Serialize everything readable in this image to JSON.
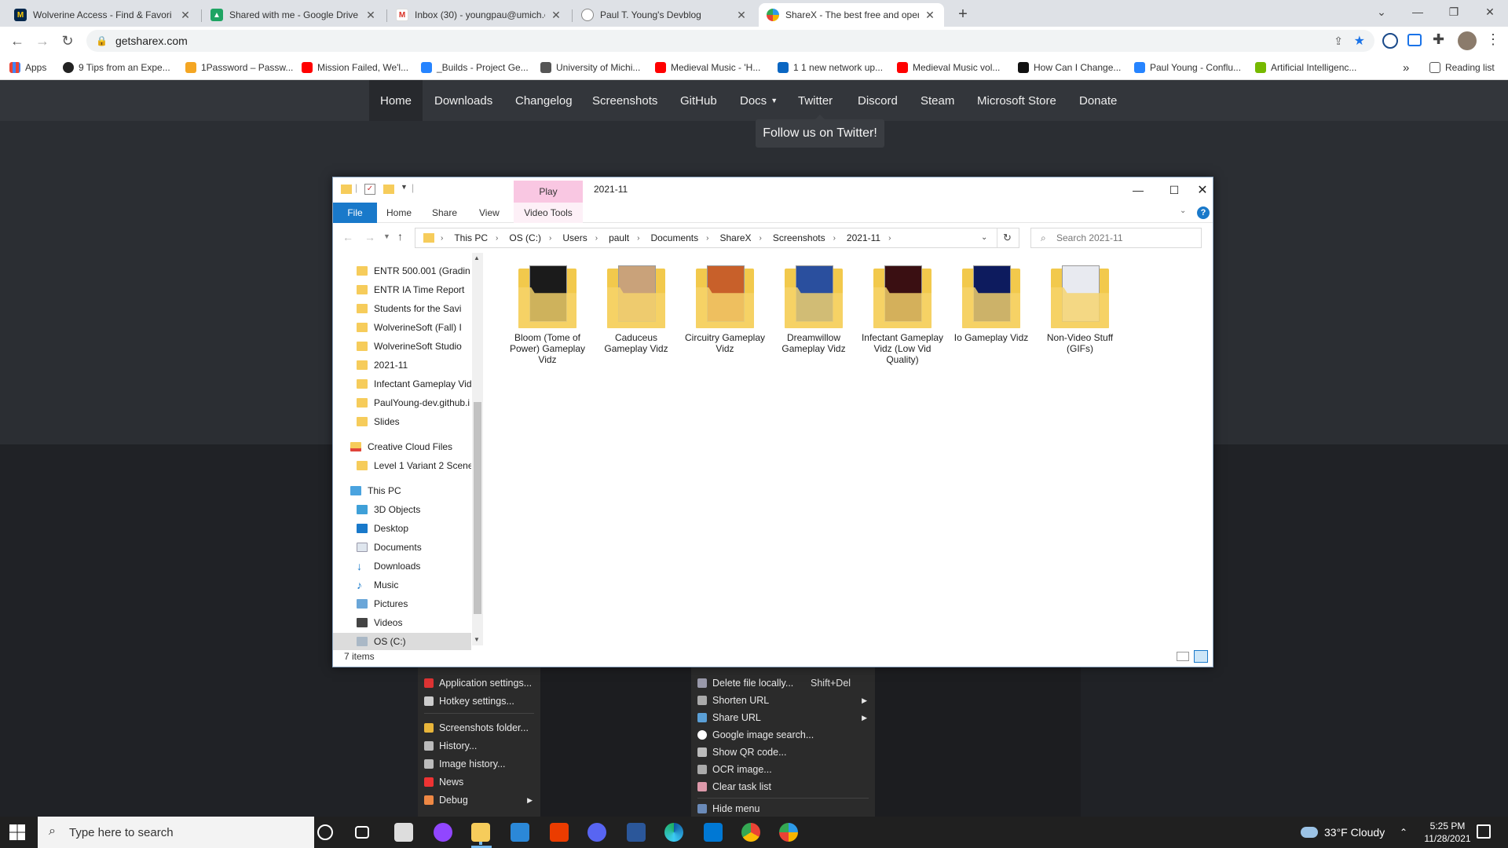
{
  "browser": {
    "tabs": [
      {
        "title": "Wolverine Access - Find & Favori",
        "icon": "wolverine-icon",
        "color": "#00274c"
      },
      {
        "title": "Shared with me - Google Drive",
        "icon": "drive-icon",
        "color": "#1fa463"
      },
      {
        "title": "Inbox (30) - youngpau@umich.e",
        "icon": "gmail-icon",
        "color": "#d93025"
      },
      {
        "title": "Paul T. Young's Devblog",
        "icon": "globe-icon",
        "color": "#666666"
      },
      {
        "title": "ShareX - The best free and open",
        "icon": "sharex-icon",
        "color": "#2d9ae8"
      }
    ],
    "new_tab": "+",
    "url": "getsharex.com",
    "bookmarks": [
      {
        "label": "Apps"
      },
      {
        "label": "9 Tips from an Expe..."
      },
      {
        "label": "1Password – Passw..."
      },
      {
        "label": "Mission Failed, We'l..."
      },
      {
        "label": "_Builds - Project Ge..."
      },
      {
        "label": "University of Michi..."
      },
      {
        "label": "Medieval Music - 'H..."
      },
      {
        "label": "1 1 new network up..."
      },
      {
        "label": "Medieval Music vol..."
      },
      {
        "label": "How Can I Change..."
      },
      {
        "label": "Paul Young - Conflu..."
      },
      {
        "label": "Artificial Intelligenc..."
      }
    ],
    "more": "»",
    "reading_list": "Reading list"
  },
  "site": {
    "nav": [
      "Home",
      "Downloads",
      "Changelog",
      "Screenshots",
      "GitHub",
      "Docs",
      "Twitter",
      "Discord",
      "Steam",
      "Microsoft Store",
      "Donate"
    ],
    "tooltip": "Follow us on Twitter!"
  },
  "sharex_menu_left": [
    {
      "label": "Application settings..."
    },
    {
      "label": "Hotkey settings..."
    },
    {
      "label": "Screenshots folder..."
    },
    {
      "label": "History..."
    },
    {
      "label": "Image history..."
    },
    {
      "label": "News"
    },
    {
      "label": "Debug"
    }
  ],
  "sharex_menu_right": [
    {
      "label": "Delete file locally...",
      "shortcut": "Shift+Del"
    },
    {
      "label": "Shorten URL"
    },
    {
      "label": "Share URL"
    },
    {
      "label": "Google image search..."
    },
    {
      "label": "Show QR code..."
    },
    {
      "label": "OCR image..."
    },
    {
      "label": "Clear task list"
    },
    {
      "label": "Hide menu"
    }
  ],
  "explorer": {
    "title": "2021-11",
    "ribbon_context": "Play",
    "tabs": [
      "File",
      "Home",
      "Share",
      "View",
      "Video Tools"
    ],
    "breadcrumb": [
      "This PC",
      "OS (C:)",
      "Users",
      "pault",
      "Documents",
      "ShareX",
      "Screenshots",
      "2021-11"
    ],
    "search_placeholder": "Search 2021-11",
    "nav_quick": [
      "ENTR 500.001 (Gradin",
      "ENTR IA Time Report",
      "Students for the Savi",
      "WolverineSoft (Fall) I",
      "WolverineSoft Studio",
      "2021-11",
      "Infectant Gameplay Vid",
      "PaulYoung-dev.github.i",
      "Slides"
    ],
    "nav_cloud": "Creative Cloud Files",
    "nav_cloud_child": "Level 1 Variant 2 Scene-",
    "nav_pc": "This PC",
    "nav_pc_items": [
      "3D Objects",
      "Desktop",
      "Documents",
      "Downloads",
      "Music",
      "Pictures",
      "Videos",
      "OS (C:)"
    ],
    "folders": [
      {
        "name": "Bloom (Tome of Power) Gameplay Vidz",
        "color": "#1b1b1b"
      },
      {
        "name": "Caduceus Gameplay Vidz",
        "color": "#c9a27a"
      },
      {
        "name": "Circuitry Gameplay Vidz",
        "color": "#c8602a"
      },
      {
        "name": "Dreamwillow Gameplay Vidz",
        "color": "#2a4f9e"
      },
      {
        "name": "Infectant Gameplay Vidz (Low Vid Quality)",
        "color": "#3a0f12"
      },
      {
        "name": "Io Gameplay Vidz",
        "color": "#0d1b5e"
      },
      {
        "name": "Non-Video Stuff (GIFs)",
        "color": "#e8eaf0"
      }
    ],
    "status": "7 items"
  },
  "taskbar": {
    "search_placeholder": "Type here to search",
    "weather": "33°F  Cloudy",
    "time": "5:25 PM",
    "date": "11/28/2021"
  }
}
